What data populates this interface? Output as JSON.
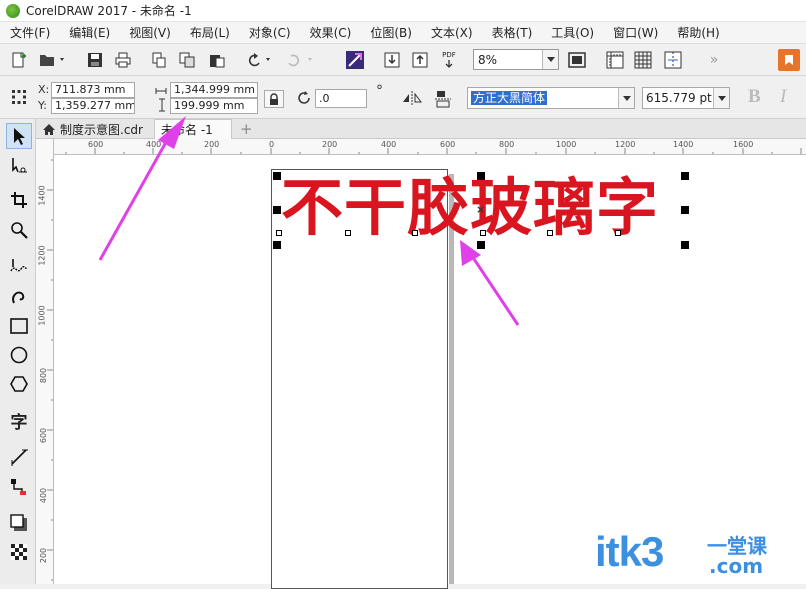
{
  "window": {
    "title": "CorelDRAW 2017 - 未命名 -1"
  },
  "menu": [
    "文件(F)",
    "编辑(E)",
    "视图(V)",
    "布局(L)",
    "对象(C)",
    "效果(C)",
    "位图(B)",
    "文本(X)",
    "表格(T)",
    "工具(O)",
    "窗口(W)",
    "帮助(H)"
  ],
  "toolbar": {
    "icons": [
      "new-icon",
      "open-icon",
      "save-icon",
      "print-icon",
      "import-icon",
      "export-icon",
      "pdf-icon",
      "undo-icon",
      "redo-icon",
      "launch-icon"
    ],
    "pdf_label": "PDF",
    "zoom": "8%",
    "overflow": "»"
  },
  "props": {
    "x_label": "X:",
    "x": "711.873 mm",
    "y_label": "Y:",
    "y": "1,359.277 mm",
    "width": "1,344.999 mm",
    "height": "199.999 mm",
    "rotation": ".0",
    "degree": "°",
    "font_name": "方正大黑简体",
    "font_size": "615.779 pt",
    "bold": "B",
    "italic": "I"
  },
  "tabs": [
    {
      "label": "制度示意图.cdr",
      "active": false
    },
    {
      "label": "未命名 -1",
      "active": true
    }
  ],
  "tab_add": "+",
  "toolbox": [
    "pick-tool",
    "shape-tool",
    "crop-tool",
    "zoom-tool",
    "freehand-tool",
    "artistic-media-tool",
    "rectangle-tool",
    "ellipse-tool",
    "polygon-tool",
    "text-tool",
    "parallel-dimension-tool",
    "connector-tool",
    "drop-shadow-tool",
    "transparency-tool"
  ],
  "text_tool_glyph": "字",
  "ruler": {
    "h": [
      "600",
      "400",
      "200",
      "0",
      "200",
      "400",
      "600",
      "800",
      "1000",
      "1200",
      "1400",
      "1600"
    ],
    "v": [
      "1400",
      "1200",
      "1000",
      "800",
      "600",
      "400",
      "200"
    ]
  },
  "canvas": {
    "artistic_text": "不干胶玻璃字",
    "text_color": "#d9161f"
  },
  "watermark": {
    "brand": "itk3",
    "domain": ".com",
    "tagline": "一堂课"
  },
  "colors": {
    "accent_arrow": "#e040e8",
    "selection_blue": "#1f6fd8"
  }
}
